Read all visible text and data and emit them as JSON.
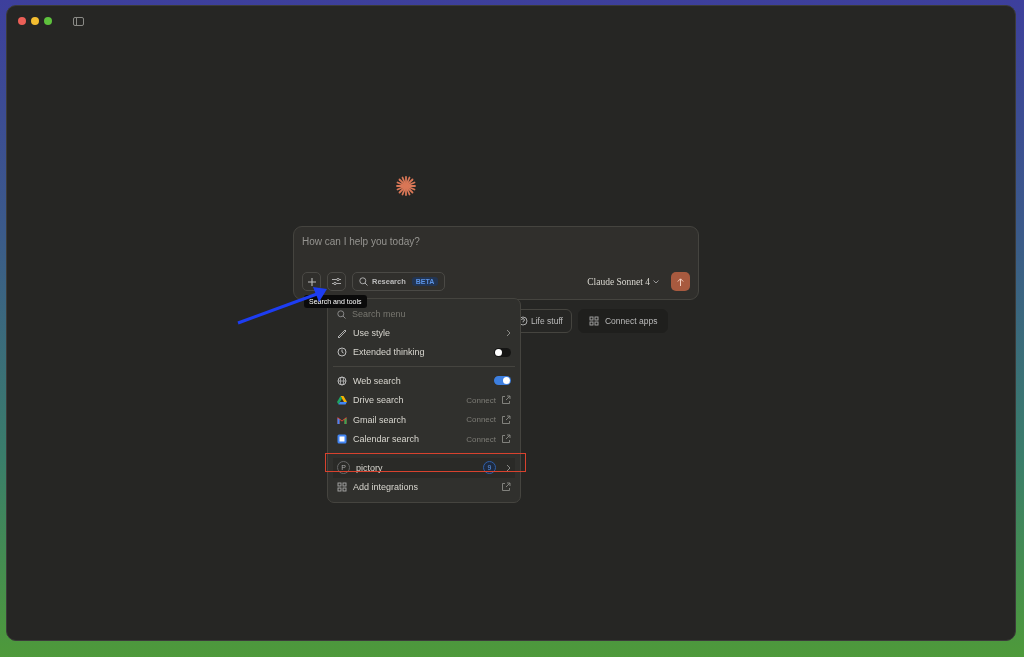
{
  "composer": {
    "placeholder": "How can I help you today?",
    "research_label": "Research",
    "research_badge": "BETA",
    "model": "Claude Sonnet 4"
  },
  "tooltip": "Search and tools",
  "suggestions": [
    {
      "label": "Life stuff",
      "kind": "question"
    },
    {
      "label": "Connect apps",
      "kind": "grid"
    }
  ],
  "menu": {
    "search_placeholder": "Search menu",
    "sections": [
      [
        {
          "label": "Use style",
          "kind": "submenu"
        },
        {
          "label": "Extended thinking",
          "kind": "toggle",
          "on": false
        }
      ],
      [
        {
          "label": "Web search",
          "kind": "toggle",
          "on": true
        },
        {
          "label": "Drive search",
          "kind": "connect",
          "action": "Connect"
        },
        {
          "label": "Gmail search",
          "kind": "connect",
          "action": "Connect"
        },
        {
          "label": "Calendar search",
          "kind": "connect",
          "action": "Connect"
        }
      ],
      [
        {
          "label": "pictory",
          "kind": "integration",
          "initial": "P",
          "count": "9",
          "highlighted": true
        },
        {
          "label": "Add integrations",
          "kind": "link"
        }
      ]
    ]
  }
}
